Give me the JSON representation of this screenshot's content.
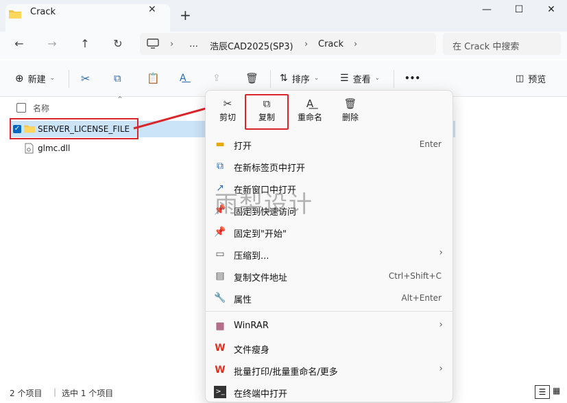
{
  "window": {
    "tab_title": "Crack",
    "tab_close": "✕",
    "new_tab": "+",
    "minimize": "—",
    "maximize": "☐",
    "close": "✕"
  },
  "nav": {
    "back": "←",
    "forward": "→",
    "up": "↑",
    "refresh": "↻",
    "more": "…",
    "breadcrumbs": [
      "浩辰CAD2025(SP3)",
      "Crack"
    ],
    "search_placeholder": "在 Crack 中搜索"
  },
  "toolbar": {
    "new_label": "新建",
    "sort_label": "排序",
    "view_label": "查看",
    "more": "•••",
    "preview_label": "预览"
  },
  "files": {
    "column_name": "名称",
    "rows": [
      {
        "name": "SERVER_LICENSE_FILE",
        "type": "folder",
        "selected": true
      },
      {
        "name": "glmc.dll",
        "type": "file",
        "selected": false
      }
    ]
  },
  "status": {
    "count": "2 个项目",
    "selected": "选中 1 个项目"
  },
  "context_menu": {
    "quick_actions": [
      {
        "label": "剪切",
        "icon": "scissors-icon"
      },
      {
        "label": "复制",
        "icon": "copy-icon"
      },
      {
        "label": "重命名",
        "icon": "rename-icon"
      },
      {
        "label": "删除",
        "icon": "trash-icon"
      }
    ],
    "items": [
      {
        "label": "打开",
        "key": "Enter",
        "icon": "folder-icon"
      },
      {
        "label": "在新标签页中打开",
        "key": "",
        "icon": "new-tab-icon"
      },
      {
        "label": "在新窗口中打开",
        "key": "",
        "icon": "new-window-icon"
      },
      {
        "label": "固定到快速访问",
        "key": "",
        "icon": "pin-icon"
      },
      {
        "label": "固定到\"开始\"",
        "key": "",
        "icon": "pin-icon"
      },
      {
        "label": "压缩到...",
        "key": "",
        "icon": "zip-icon",
        "submenu": true
      },
      {
        "label": "复制文件地址",
        "key": "Ctrl+Shift+C",
        "icon": "path-icon"
      },
      {
        "label": "属性",
        "key": "Alt+Enter",
        "icon": "wrench-icon"
      },
      {
        "label": "WinRAR",
        "key": "",
        "icon": "winrar-icon",
        "submenu": true
      },
      {
        "label": "文件瘦身",
        "key": "",
        "icon": "wps-icon"
      },
      {
        "label": "批量打印/批量重命名/更多",
        "key": "",
        "icon": "wps-icon",
        "submenu": true
      },
      {
        "label": "在终端中打开",
        "key": "",
        "icon": "terminal-icon"
      }
    ]
  },
  "watermark": "雨梨设计",
  "colors": {
    "accent": "#0067c0",
    "highlight_red": "#d9262b",
    "selection": "#cce4f7"
  }
}
